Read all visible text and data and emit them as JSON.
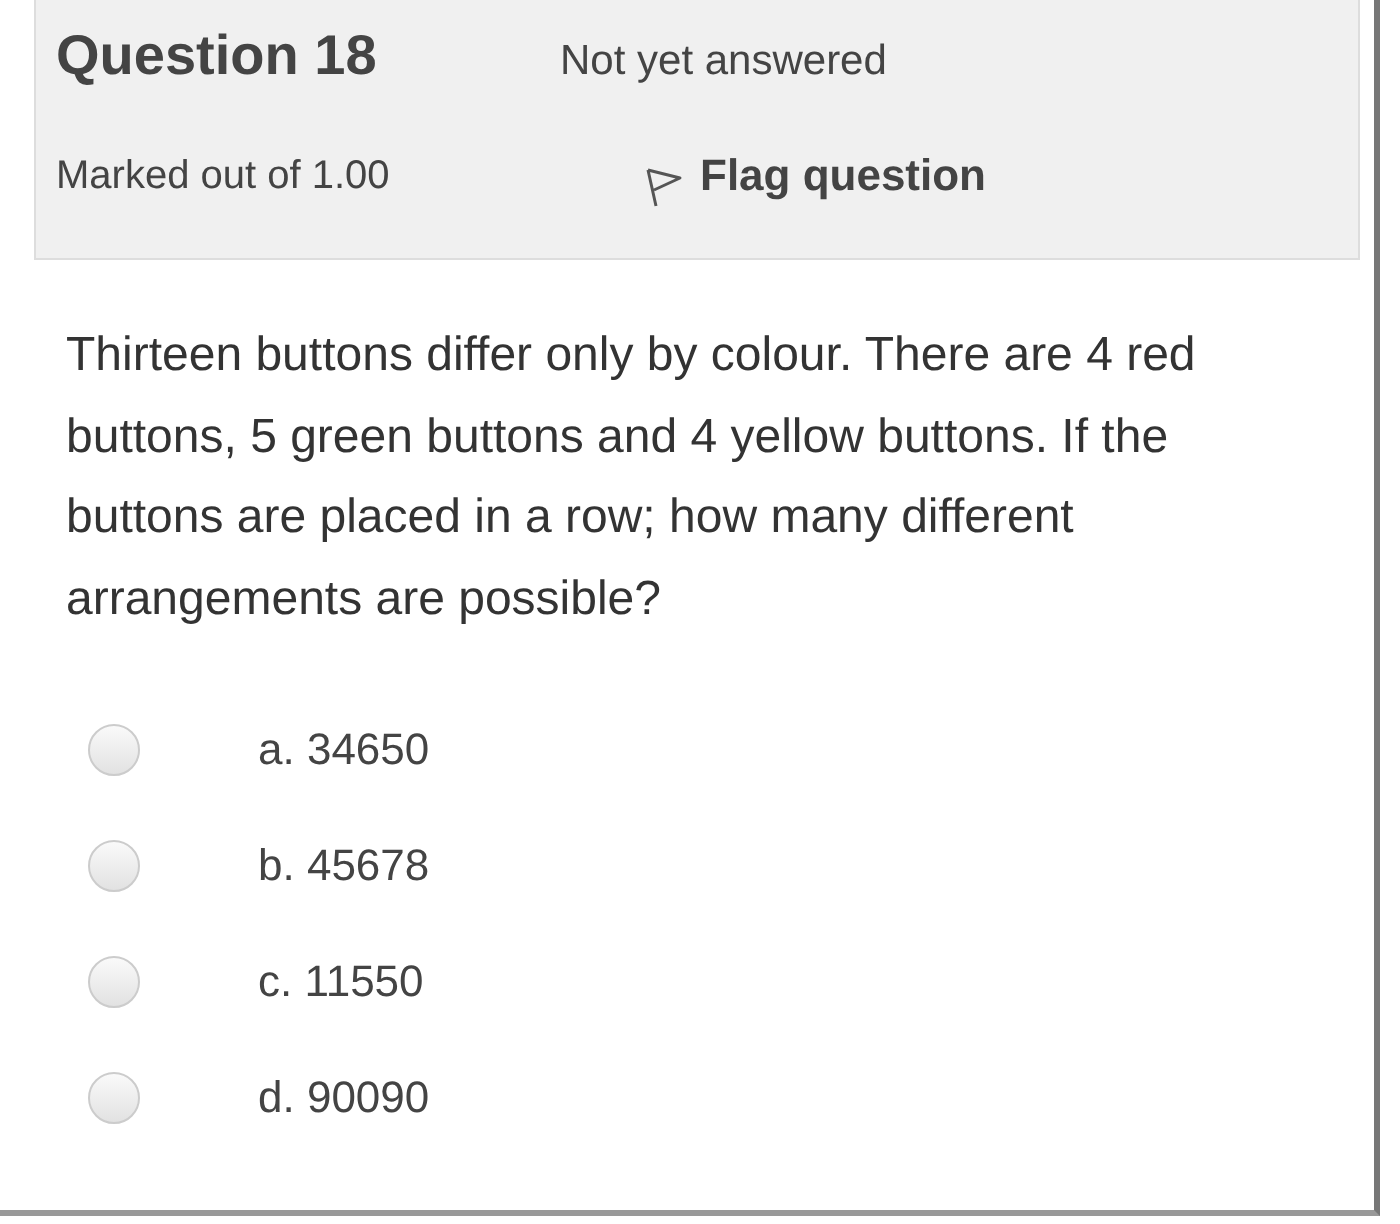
{
  "info": {
    "title": "Question 18",
    "status": "Not yet answered",
    "marks": "Marked out of 1.00",
    "flag_label": "Flag question"
  },
  "question": "Thirteen buttons differ only by colour. There are 4 red buttons, 5 green buttons and 4 yellow buttons. If the buttons are placed in a row; how many different arrangements are possible?",
  "options": [
    {
      "label": "a. 34650",
      "selected": false
    },
    {
      "label": "b. 45678",
      "selected": false
    },
    {
      "label": "c. 11550",
      "selected": false
    },
    {
      "label": "d. 90090",
      "selected": false
    }
  ]
}
